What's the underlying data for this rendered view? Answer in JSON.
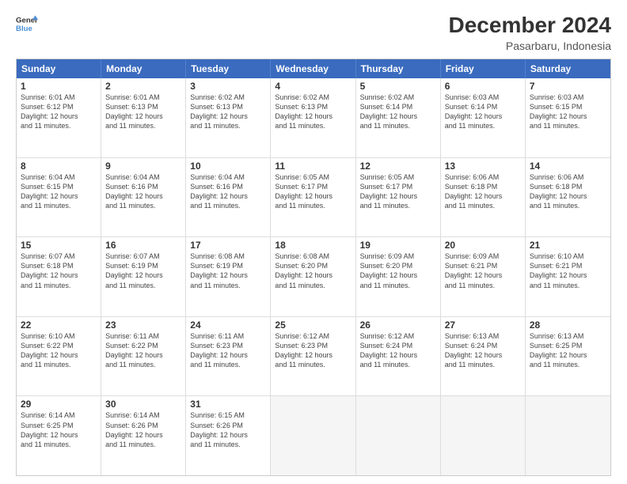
{
  "logo": {
    "line1": "General",
    "line2": "Blue"
  },
  "title": "December 2024",
  "subtitle": "Pasarbaru, Indonesia",
  "header_days": [
    "Sunday",
    "Monday",
    "Tuesday",
    "Wednesday",
    "Thursday",
    "Friday",
    "Saturday"
  ],
  "rows": [
    [
      {
        "day": "1",
        "info": "Sunrise: 6:01 AM\nSunset: 6:12 PM\nDaylight: 12 hours\nand 11 minutes."
      },
      {
        "day": "2",
        "info": "Sunrise: 6:01 AM\nSunset: 6:13 PM\nDaylight: 12 hours\nand 11 minutes."
      },
      {
        "day": "3",
        "info": "Sunrise: 6:02 AM\nSunset: 6:13 PM\nDaylight: 12 hours\nand 11 minutes."
      },
      {
        "day": "4",
        "info": "Sunrise: 6:02 AM\nSunset: 6:13 PM\nDaylight: 12 hours\nand 11 minutes."
      },
      {
        "day": "5",
        "info": "Sunrise: 6:02 AM\nSunset: 6:14 PM\nDaylight: 12 hours\nand 11 minutes."
      },
      {
        "day": "6",
        "info": "Sunrise: 6:03 AM\nSunset: 6:14 PM\nDaylight: 12 hours\nand 11 minutes."
      },
      {
        "day": "7",
        "info": "Sunrise: 6:03 AM\nSunset: 6:15 PM\nDaylight: 12 hours\nand 11 minutes."
      }
    ],
    [
      {
        "day": "8",
        "info": "Sunrise: 6:04 AM\nSunset: 6:15 PM\nDaylight: 12 hours\nand 11 minutes."
      },
      {
        "day": "9",
        "info": "Sunrise: 6:04 AM\nSunset: 6:16 PM\nDaylight: 12 hours\nand 11 minutes."
      },
      {
        "day": "10",
        "info": "Sunrise: 6:04 AM\nSunset: 6:16 PM\nDaylight: 12 hours\nand 11 minutes."
      },
      {
        "day": "11",
        "info": "Sunrise: 6:05 AM\nSunset: 6:17 PM\nDaylight: 12 hours\nand 11 minutes."
      },
      {
        "day": "12",
        "info": "Sunrise: 6:05 AM\nSunset: 6:17 PM\nDaylight: 12 hours\nand 11 minutes."
      },
      {
        "day": "13",
        "info": "Sunrise: 6:06 AM\nSunset: 6:18 PM\nDaylight: 12 hours\nand 11 minutes."
      },
      {
        "day": "14",
        "info": "Sunrise: 6:06 AM\nSunset: 6:18 PM\nDaylight: 12 hours\nand 11 minutes."
      }
    ],
    [
      {
        "day": "15",
        "info": "Sunrise: 6:07 AM\nSunset: 6:18 PM\nDaylight: 12 hours\nand 11 minutes."
      },
      {
        "day": "16",
        "info": "Sunrise: 6:07 AM\nSunset: 6:19 PM\nDaylight: 12 hours\nand 11 minutes."
      },
      {
        "day": "17",
        "info": "Sunrise: 6:08 AM\nSunset: 6:19 PM\nDaylight: 12 hours\nand 11 minutes."
      },
      {
        "day": "18",
        "info": "Sunrise: 6:08 AM\nSunset: 6:20 PM\nDaylight: 12 hours\nand 11 minutes."
      },
      {
        "day": "19",
        "info": "Sunrise: 6:09 AM\nSunset: 6:20 PM\nDaylight: 12 hours\nand 11 minutes."
      },
      {
        "day": "20",
        "info": "Sunrise: 6:09 AM\nSunset: 6:21 PM\nDaylight: 12 hours\nand 11 minutes."
      },
      {
        "day": "21",
        "info": "Sunrise: 6:10 AM\nSunset: 6:21 PM\nDaylight: 12 hours\nand 11 minutes."
      }
    ],
    [
      {
        "day": "22",
        "info": "Sunrise: 6:10 AM\nSunset: 6:22 PM\nDaylight: 12 hours\nand 11 minutes."
      },
      {
        "day": "23",
        "info": "Sunrise: 6:11 AM\nSunset: 6:22 PM\nDaylight: 12 hours\nand 11 minutes."
      },
      {
        "day": "24",
        "info": "Sunrise: 6:11 AM\nSunset: 6:23 PM\nDaylight: 12 hours\nand 11 minutes."
      },
      {
        "day": "25",
        "info": "Sunrise: 6:12 AM\nSunset: 6:23 PM\nDaylight: 12 hours\nand 11 minutes."
      },
      {
        "day": "26",
        "info": "Sunrise: 6:12 AM\nSunset: 6:24 PM\nDaylight: 12 hours\nand 11 minutes."
      },
      {
        "day": "27",
        "info": "Sunrise: 6:13 AM\nSunset: 6:24 PM\nDaylight: 12 hours\nand 11 minutes."
      },
      {
        "day": "28",
        "info": "Sunrise: 6:13 AM\nSunset: 6:25 PM\nDaylight: 12 hours\nand 11 minutes."
      }
    ],
    [
      {
        "day": "29",
        "info": "Sunrise: 6:14 AM\nSunset: 6:25 PM\nDaylight: 12 hours\nand 11 minutes."
      },
      {
        "day": "30",
        "info": "Sunrise: 6:14 AM\nSunset: 6:26 PM\nDaylight: 12 hours\nand 11 minutes."
      },
      {
        "day": "31",
        "info": "Sunrise: 6:15 AM\nSunset: 6:26 PM\nDaylight: 12 hours\nand 11 minutes."
      },
      {
        "day": "",
        "info": ""
      },
      {
        "day": "",
        "info": ""
      },
      {
        "day": "",
        "info": ""
      },
      {
        "day": "",
        "info": ""
      }
    ]
  ]
}
